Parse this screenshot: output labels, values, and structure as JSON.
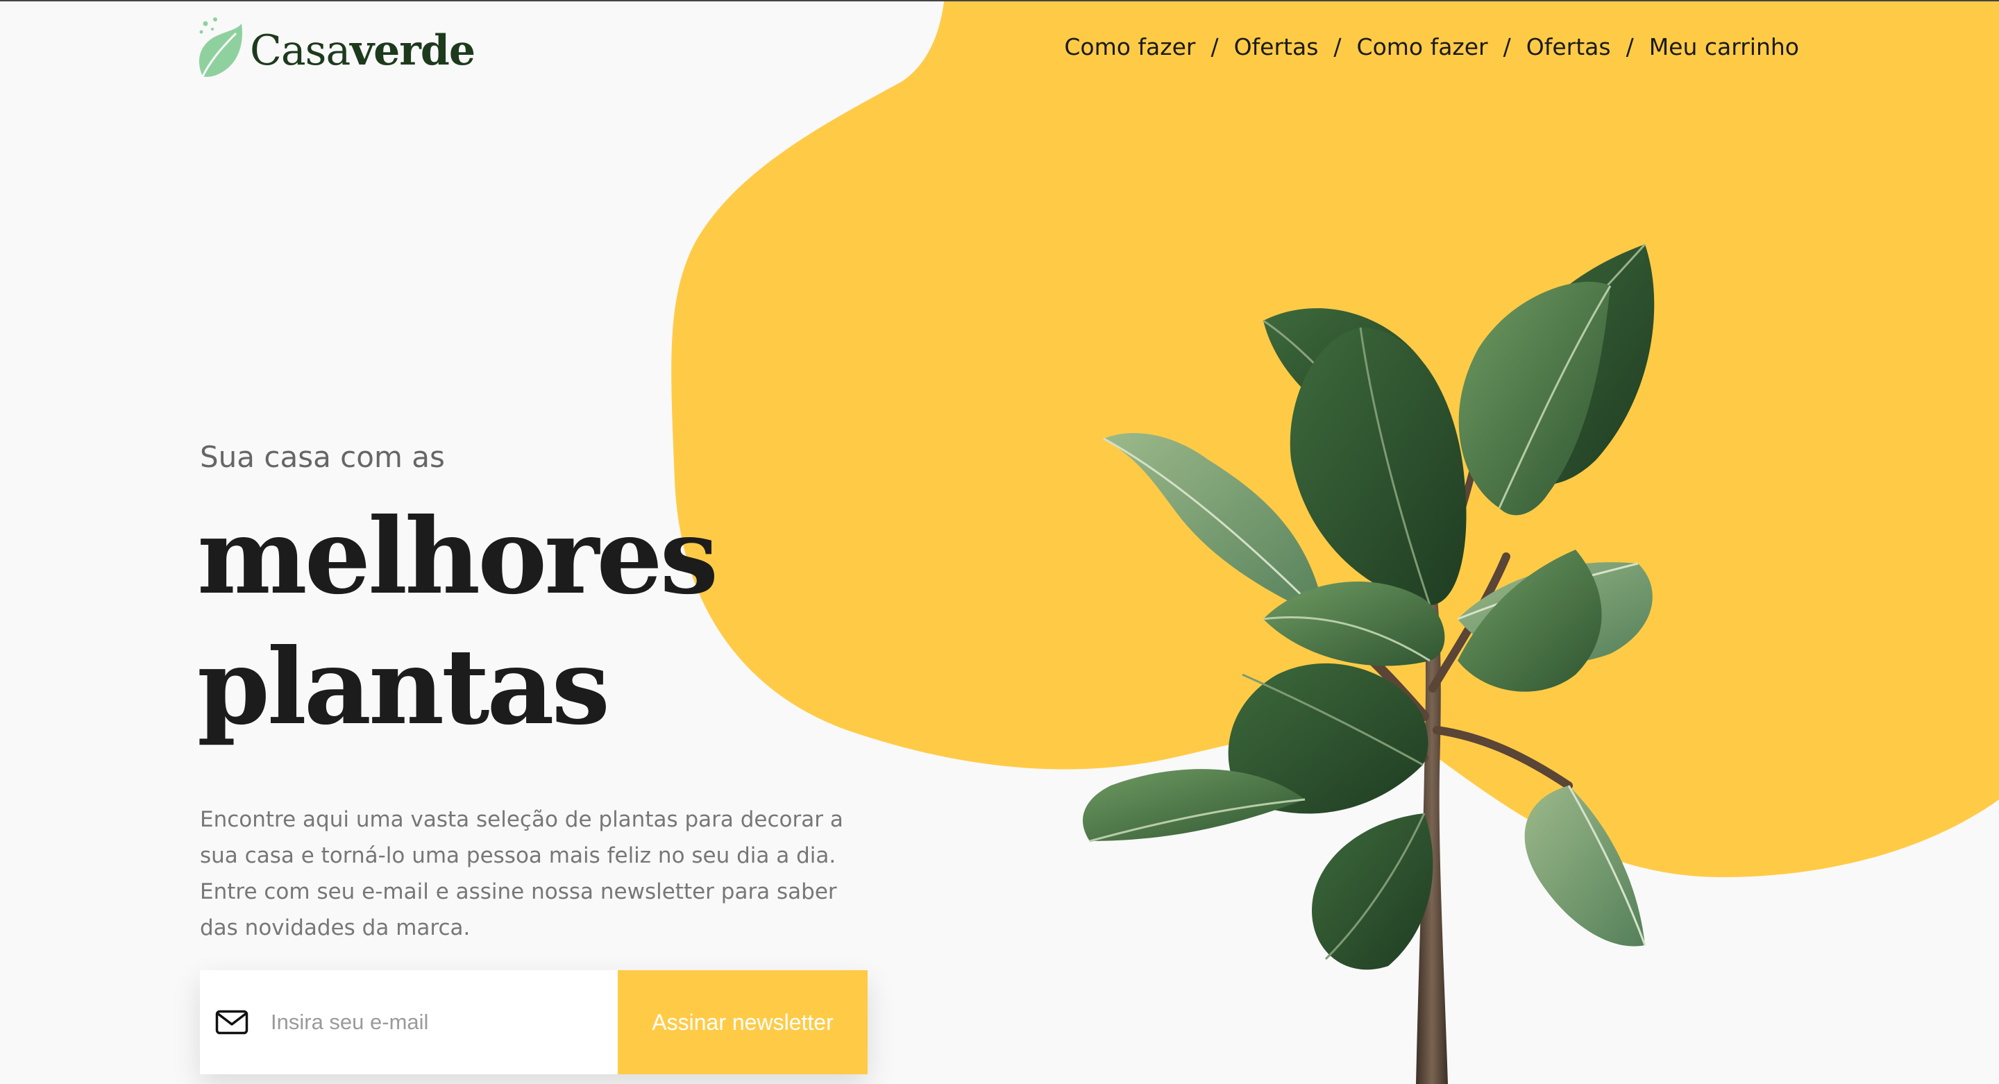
{
  "brand": {
    "name_light": "Casa",
    "name_bold": "verde",
    "logo_icon": "leaf-icon",
    "logo_color": "#8fd19e"
  },
  "nav": {
    "items": [
      {
        "label": "Como fazer"
      },
      {
        "label": "Ofertas"
      },
      {
        "label": "Como fazer"
      },
      {
        "label": "Ofertas"
      },
      {
        "label": "Meu carrinho"
      }
    ],
    "separator": "/"
  },
  "hero": {
    "subtitle": "Sua casa com as",
    "headline_line1": "melhores",
    "headline_line2": "plantas",
    "description_lines": [
      "Encontre aqui uma vasta seleção de plantas para decorar a",
      "sua casa e torná-lo uma pessoa mais feliz no seu dia a dia.",
      "Entre com seu e-mail e assine nossa newsletter para saber",
      "das novidades da marca."
    ]
  },
  "newsletter": {
    "placeholder": "Insira seu e-mail",
    "value": "",
    "icon": "mail-icon",
    "button_label": "Assinar newsletter"
  },
  "colors": {
    "accent_yellow": "#ffcb47",
    "background": "#f9f9f9",
    "text_dark": "#1c1c1c",
    "text_muted": "#777777",
    "leaf_green": "#3d6b3f"
  },
  "hero_image": {
    "subject": "fiddle-leaf-fig-plant"
  }
}
